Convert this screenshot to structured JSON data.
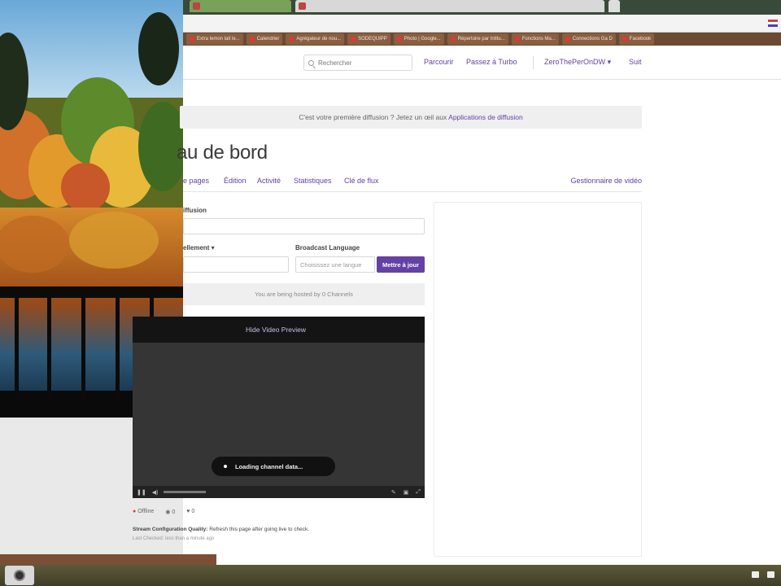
{
  "bookmarks": [
    "Extra lemon lait le...",
    "Calendrier",
    "Agrégateur de nou...",
    "SODEQUIPP",
    "Photo | Google...",
    "Répertoire par Intitu...",
    "Fonctions Ma...",
    "Connections Ga D",
    "Facebook"
  ],
  "nav": {
    "search_placeholder": "Rechercher",
    "browse": "Parcourir",
    "turbo": "Passez à Turbo",
    "user": "ZeroThePerOnDW ▾",
    "more": "Suit"
  },
  "notice": {
    "text": "C'est votre première diffusion ? Jetez un œil aux ",
    "link": "Applications de diffusion"
  },
  "dashboard": {
    "title": "au de bord",
    "tabs": [
      "e pages",
      "Édition",
      "Activité",
      "Statistiques",
      "Clé de flux"
    ],
    "video_manager": "Gestionnaire de vidéo",
    "stream_title_label": "iffusion",
    "game_label": "ellement ▾",
    "language_label": "Broadcast Language",
    "language_placeholder": "Choisissez une langue",
    "update_button": "Mettre à jour",
    "hosted_text": "You are being hosted by 0 Channels"
  },
  "player": {
    "hide_preview": "Hide Video Preview",
    "loading": "Loading channel data..."
  },
  "stats": {
    "status": "Offline",
    "viewers": "0",
    "followers": "0"
  },
  "stream_quality": {
    "label": "Stream Configuration Quality:",
    "text": " Refresh this page after going live to check.",
    "last_checked": "Last Checked: less than a minute ago"
  }
}
